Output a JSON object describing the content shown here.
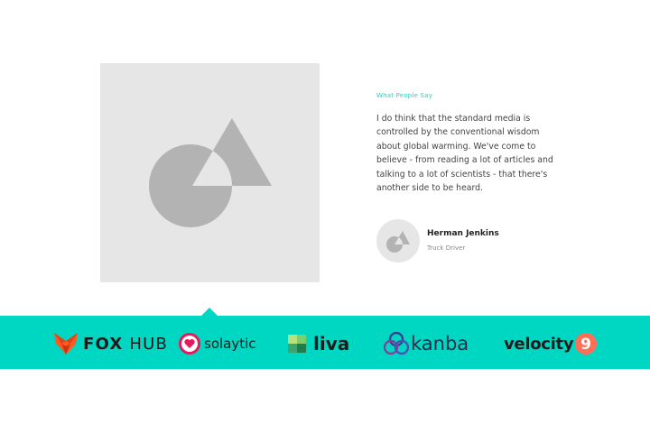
{
  "testimonial": {
    "eyebrow": "What People Say",
    "quote": "I do think that the standard media is controlled by the conventional wisdom about global warming. We've come to believe - from reading a lot of articles and talking to a lot of scientists - that there's another side to be heard.",
    "author_name": "Herman Jenkins",
    "author_role": "Truck Driver"
  },
  "logos": {
    "foxhub_a": "FOX",
    "foxhub_b": "HUB",
    "solaytic": "solaytic",
    "liva": "liva",
    "kanba": "kanba",
    "velocity": "velocity",
    "velocity_badge": "9"
  },
  "colors": {
    "accent": "#00d7c3",
    "placeholder": "#e6e6e6",
    "shape": "#b3b3b3"
  },
  "icons": {
    "image_placeholder": "image-placeholder-icon",
    "avatar": "avatar-icon"
  }
}
